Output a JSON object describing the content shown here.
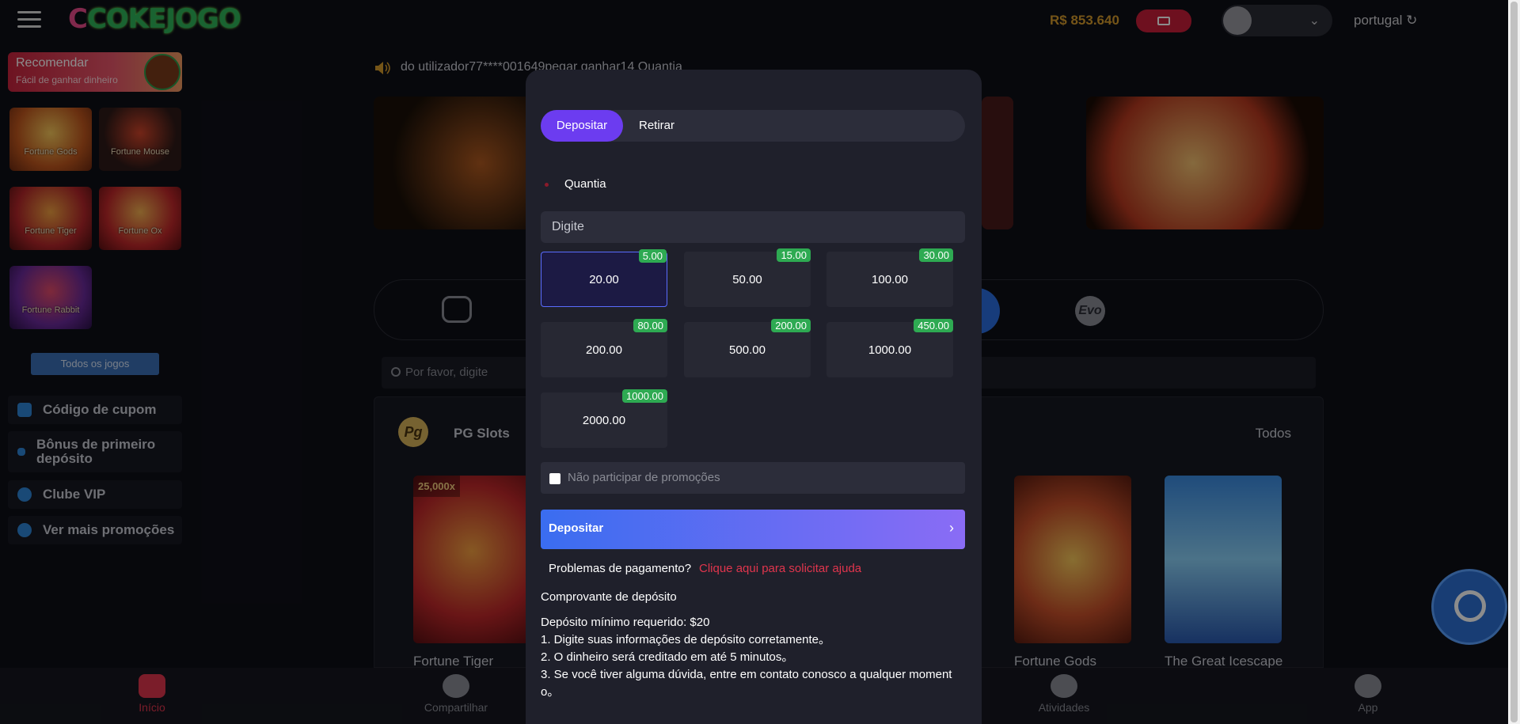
{
  "header": {
    "logo": "COKEJOGO",
    "balance": "R$ 853.640",
    "language": "portugal"
  },
  "sidebar": {
    "recommend_title": "Recomendar",
    "recommend_sub": "Fácil de ganhar dinheiro",
    "games": [
      {
        "label": "Fortune Gods"
      },
      {
        "label": "Fortune Mouse"
      },
      {
        "label": "Fortune Tiger"
      },
      {
        "label": "Fortune Ox"
      },
      {
        "label": "Fortune Rabbit"
      }
    ],
    "all_games": "Todos os jogos",
    "items": [
      {
        "label": "Código de cupom"
      },
      {
        "label": "Bônus de primeiro depósito"
      },
      {
        "label": "Clube VIP"
      },
      {
        "label": "Ver mais promoções"
      }
    ]
  },
  "main": {
    "notice": "do utilizador77****001649pegar ganhar14 Quantia",
    "evo": "Evo",
    "search_placeholder": "Por favor, digite",
    "pg_title": "PG Slots",
    "pg_all": "Todos",
    "pg_logo": "Pg",
    "cards": [
      {
        "name": "Fortune Tiger",
        "badge": "25,000x"
      },
      {
        "name": "Fortune Gods"
      },
      {
        "name": "The Great Icescape"
      }
    ]
  },
  "bottom_nav": [
    {
      "label": "Início"
    },
    {
      "label": "Compartilhar"
    },
    {
      "label": "Atividades"
    },
    {
      "label": "App"
    }
  ],
  "modal": {
    "tabs": [
      {
        "label": "Depositar"
      },
      {
        "label": "Retirar"
      }
    ],
    "amount_label": "Quantia",
    "amount_placeholder": "Digite",
    "options": [
      {
        "amount": "20.00",
        "bonus": "5.00"
      },
      {
        "amount": "50.00",
        "bonus": "15.00"
      },
      {
        "amount": "100.00",
        "bonus": "30.00"
      },
      {
        "amount": "200.00",
        "bonus": "80.00"
      },
      {
        "amount": "500.00",
        "bonus": "200.00"
      },
      {
        "amount": "1000.00",
        "bonus": "450.00"
      },
      {
        "amount": "2000.00",
        "bonus": "1000.00"
      }
    ],
    "no_promo": "Não participar de promoções",
    "deposit_button": "Depositar",
    "problems": "Problemas de pagamento?",
    "help_link": "Clique aqui para solicitar ajuda",
    "receipt": "Comprovante de depósito",
    "min_deposit": "Depósito mínimo requerido: $20",
    "instructions": [
      "1. Digite suas informações de depósito corretamente。",
      "2. O dinheiro será creditado em até 5 minutos。",
      "3. Se você tiver alguma dúvida, entre em contato conosco a qualquer momento。"
    ]
  },
  "colors": {
    "accent_purple": "#6c3cf0",
    "accent_red": "#e0354d",
    "bonus_green": "#2eaa52",
    "balance_gold": "#d69b2c"
  }
}
